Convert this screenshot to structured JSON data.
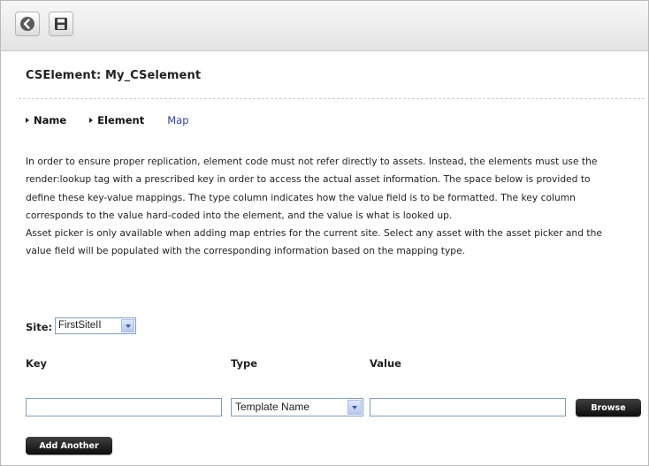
{
  "toolbar": {
    "back_icon": "back-arrow-icon",
    "save_icon": "save-disk-icon"
  },
  "title": "CSElement: My_CSelement",
  "tabs": [
    {
      "label": "Name",
      "active": false
    },
    {
      "label": "Element",
      "active": false
    },
    {
      "label": "Map",
      "active": true
    }
  ],
  "description": {
    "lines": [
      "In order to ensure proper replication, element code must not refer directly to assets. Instead, the elements must use the",
      "render:lookup tag with a prescribed key in order to access the actual asset information. The space below is provided to",
      "define these key-value mappings. The type column indicates how the value field is to be formatted. The key column",
      "corresponds to the value hard-coded into the element, and the value is what is looked up.",
      "Asset picker is only available when adding map entries for the current site. Select any asset with the asset picker and the",
      "value field will be populated with the corresponding information based on the mapping type."
    ]
  },
  "site": {
    "label": "Site:",
    "selected": "FirstSiteII"
  },
  "columns": {
    "key": "Key",
    "type": "Type",
    "value": "Value"
  },
  "row": {
    "key_value": "",
    "type_selected": "Template Name",
    "value_value": ""
  },
  "buttons": {
    "browse": "Browse",
    "add_another": "Add Another"
  },
  "colors": {
    "active_tab": "#2a3fa8",
    "button_dark": "#1a1a1a"
  }
}
